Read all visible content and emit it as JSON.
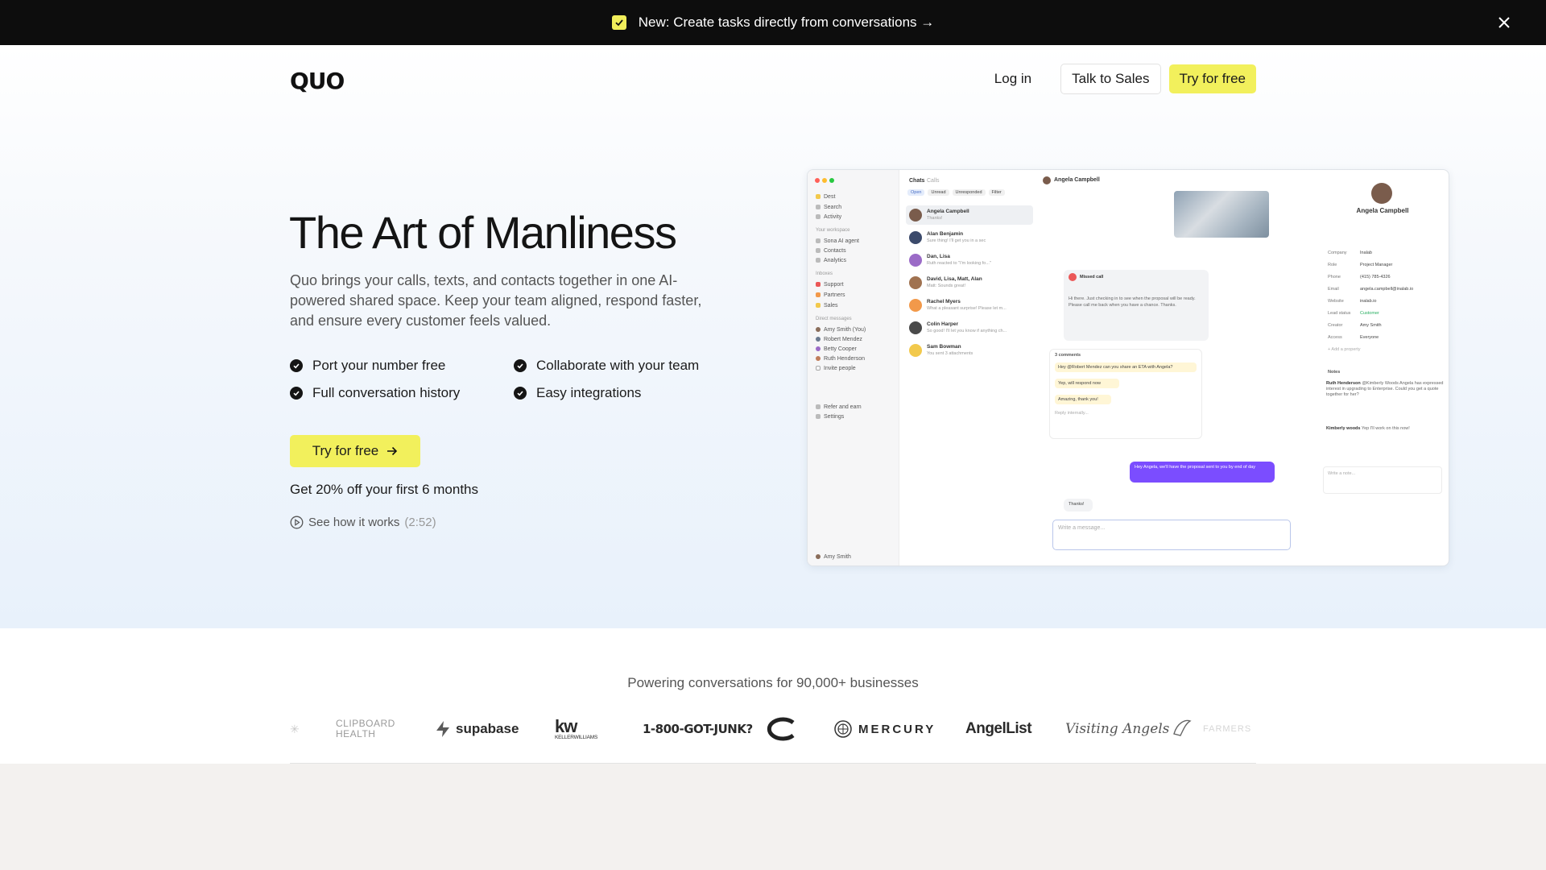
{
  "announcement": {
    "text": "New: Create tasks directly from conversations →"
  },
  "header": {
    "logo": "QUO",
    "login": "Log in",
    "talk_to_sales": "Talk to Sales",
    "try_free": "Try for free"
  },
  "hero": {
    "title": "The Art of Manliness",
    "description": "Quo brings your calls, texts, and contacts together in one AI-powered shared space. Keep your team aligned, respond faster, and ensure every customer feels valued.",
    "features": [
      "Port your number free",
      "Collaborate with your team",
      "Full conversation history",
      "Easy integrations"
    ],
    "cta": "Try for free",
    "offer": "Get 20% off your first 6 months",
    "how_label": "See how it works",
    "how_duration": "(2:52)"
  },
  "mockup": {
    "workspace": "Dest",
    "sidebar": {
      "top": [
        "Search",
        "Activity"
      ],
      "your_workspace_label": "Your workspace",
      "workspace": [
        "Sona AI agent",
        "Contacts",
        "Analytics"
      ],
      "inboxes_label": "Inboxes",
      "inboxes": [
        "Support",
        "Partners",
        "Sales"
      ],
      "direct_label": "Direct messages",
      "direct": [
        "Amy Smith (You)",
        "Robert Mendez",
        "Betty Cooper",
        "Ruth Henderson",
        "Invite people"
      ],
      "bottom": [
        "Refer and earn",
        "Settings"
      ],
      "user": "Amy Smith"
    },
    "list_tabs": [
      "Chats",
      "Calls"
    ],
    "filters": [
      "Open",
      "Unread",
      "Unresponded",
      "Filter"
    ],
    "conversations": [
      {
        "name": "Angela Campbell",
        "preview": "Thanks!"
      },
      {
        "name": "Alan Benjamin",
        "preview": "Sure thing! I'll get you in a sec"
      },
      {
        "name": "Dan, Lisa",
        "preview": "Ruth reacted to \"I'm looking fo...\""
      },
      {
        "name": "David, Lisa, Matt, Alan",
        "preview": "Matt: Sounds great!"
      },
      {
        "name": "Rachel Myers",
        "preview": "What a pleasant surprise! Please let m..."
      },
      {
        "name": "Colin Harper",
        "preview": "So good! I'll let you know if anything ch..."
      },
      {
        "name": "Sam Bowman",
        "preview": "You sent 3 attachments"
      }
    ],
    "chat": {
      "contact": "Angela Campbell",
      "missed_call": "Missed call",
      "voicemail": "Hi there. Just checking in to see when the proposal will be ready. Please call me back when you have a chance. Thanks.",
      "comments": "3 comments",
      "thread": [
        "Hey @Robert Mendez can you share an ETA with Angela?",
        "Yep, will respond now",
        "Amazing, thank you!"
      ],
      "reply_placeholder": "Reply internally...",
      "outgoing": "Hey Angela, we'll have the proposal sent to you by end of day",
      "incoming": "Thanks!",
      "composer": "Write a message..."
    },
    "panel": {
      "name": "Angela Campbell",
      "props": [
        {
          "k": "Company",
          "v": "Inalab"
        },
        {
          "k": "Role",
          "v": "Project Manager"
        },
        {
          "k": "Phone",
          "v": "(415) 785-4326"
        },
        {
          "k": "Email",
          "v": "angela.campbell@inalab.io"
        },
        {
          "k": "Website",
          "v": "inalab.io"
        },
        {
          "k": "Lead status",
          "v": "Customer"
        },
        {
          "k": "Creator",
          "v": "Amy Smith"
        },
        {
          "k": "Access",
          "v": "Everyone"
        }
      ],
      "add_property": "+ Add a property",
      "notes_label": "Notes",
      "notes": [
        {
          "author": "Ruth Henderson",
          "text": "@Kimberly Woods Angela has expressed interest in upgrading to Enterprise. Could you get a quote together for her?"
        },
        {
          "author": "Kimberly woods",
          "text": "Yep I'll work on this now!"
        }
      ],
      "note_placeholder": "Write a note..."
    }
  },
  "logos": {
    "heading": "Powering conversations for 90,000+ businesses",
    "items": [
      "CLIPBOARD HEALTH",
      "supabase",
      "KELLERWILLIAMS",
      "1-800-GOT-JUNK?",
      "MERCURY",
      "AngelList",
      "Visiting Angels",
      "FARMERS"
    ]
  },
  "colors": {
    "accent_yellow": "#f2f05c",
    "dark": "#0d0d0d",
    "purple_bubble": "#7b4dff"
  }
}
